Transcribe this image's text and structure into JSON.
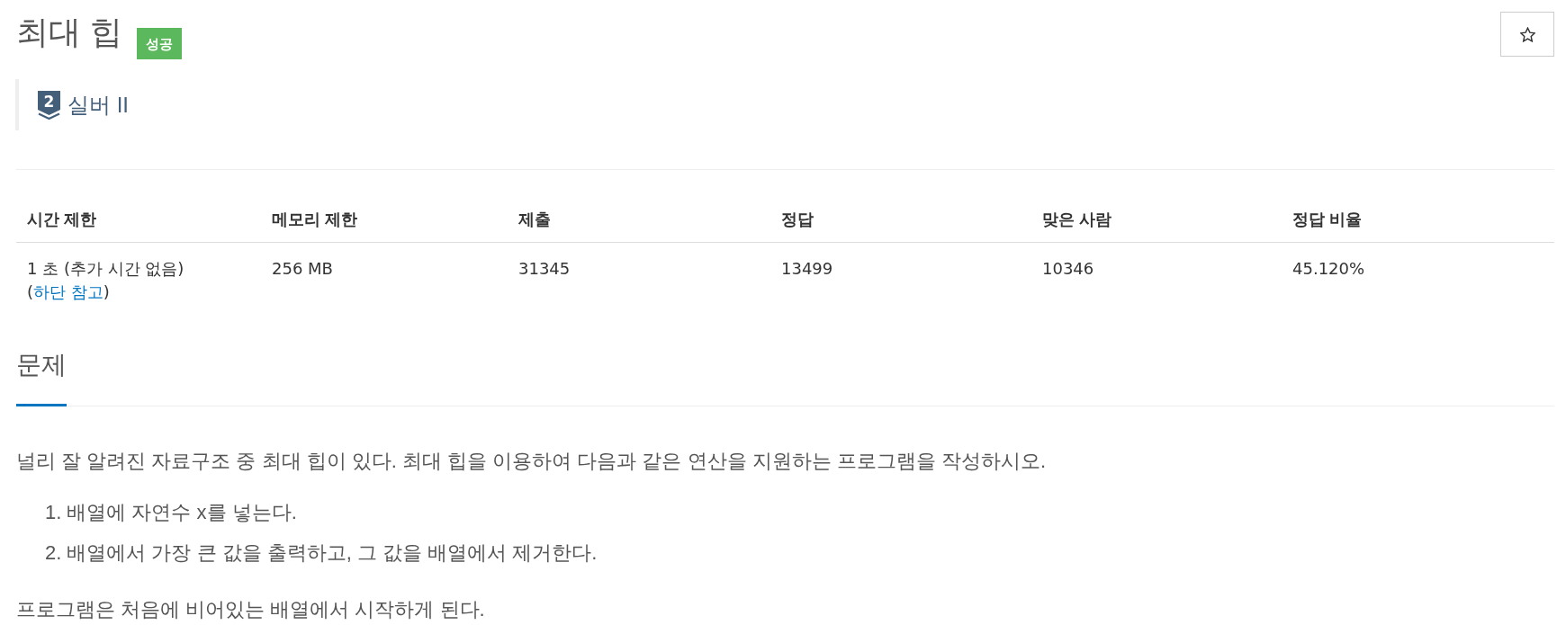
{
  "problem": {
    "title": "최대 힙",
    "result": {
      "label": "성공",
      "kind": "success"
    },
    "tier": {
      "rank": "2",
      "name": "실버 II"
    }
  },
  "favorite": {
    "starred": false
  },
  "info_table": {
    "columns": [
      "시간 제한",
      "메모리 제한",
      "제출",
      "정답",
      "맞은 사람",
      "정답 비율"
    ],
    "rows": [
      [
        {
          "parts": [
            {
              "kind": "text",
              "text": "1 초 (추가 시간 없음) ("
            },
            {
              "kind": "link",
              "text": "하단 참고"
            },
            {
              "kind": "text",
              "text": ")"
            }
          ]
        },
        {
          "parts": [
            {
              "kind": "text",
              "text": "256 MB"
            }
          ]
        },
        {
          "parts": [
            {
              "kind": "text",
              "text": "31345"
            }
          ]
        },
        {
          "parts": [
            {
              "kind": "text",
              "text": "13499"
            }
          ]
        },
        {
          "parts": [
            {
              "kind": "text",
              "text": "10346"
            }
          ]
        },
        {
          "parts": [
            {
              "kind": "text",
              "text": "45.120%"
            }
          ]
        }
      ]
    ]
  },
  "section": {
    "heading": "문제",
    "blocks": [
      {
        "kind": "paragraph",
        "text": "널리 잘 알려진 자료구조 중 최대 힙이 있다. 최대 힙을 이용하여 다음과 같은 연산을 지원하는 프로그램을 작성하시오."
      },
      {
        "kind": "ordered_list",
        "items": [
          {
            "number": "1.",
            "text": "배열에 자연수 x를 넣는다."
          },
          {
            "number": "2.",
            "text": "배열에서 가장 큰 값을 출력하고, 그 값을 배열에서 제거한다."
          }
        ]
      },
      {
        "kind": "paragraph",
        "text": "프로그램은 처음에 비어있는 배열에서 시작하게 된다."
      }
    ]
  }
}
